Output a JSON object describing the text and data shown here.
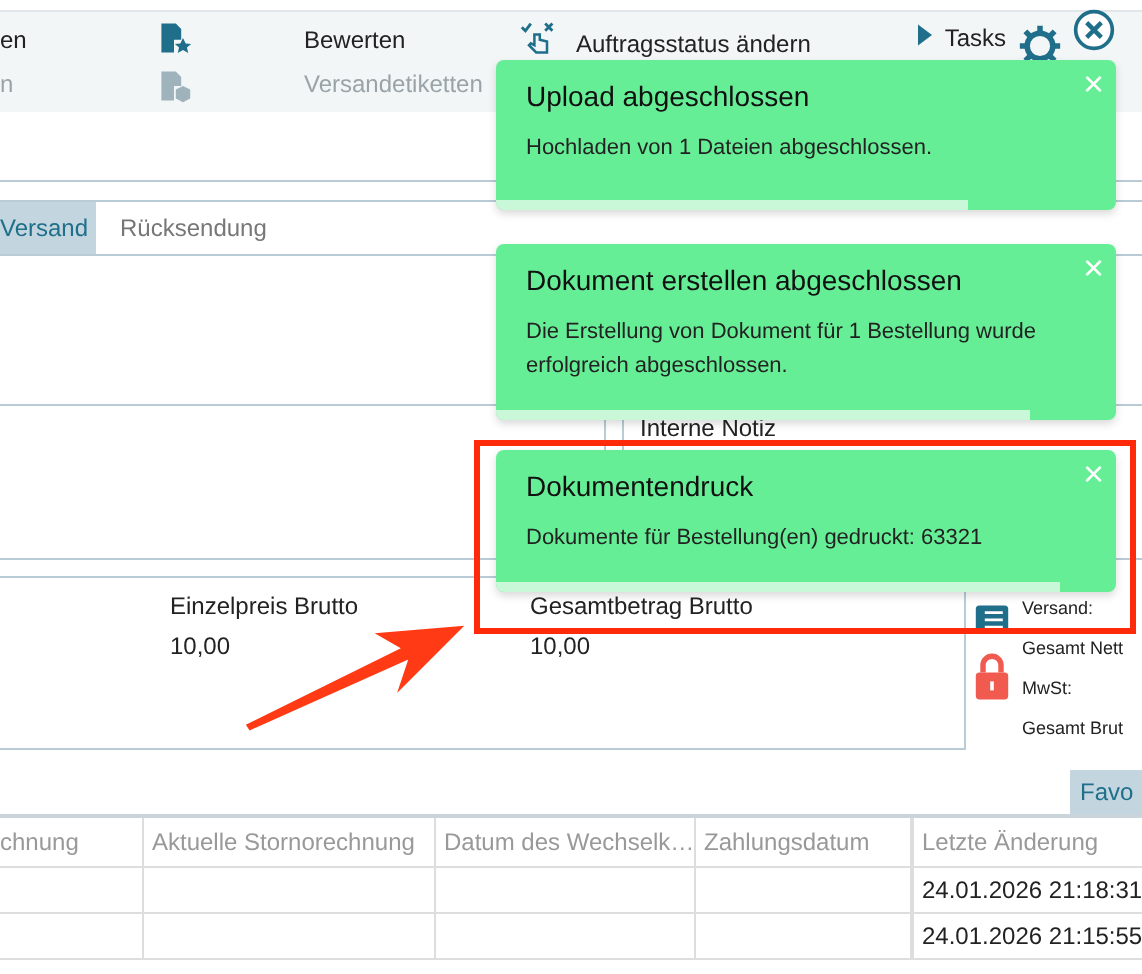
{
  "toolbar": {
    "items": [
      {
        "label": "en",
        "disabled": false
      },
      {
        "label": "n",
        "disabled": true
      },
      {
        "label": "Bewerten",
        "disabled": false
      },
      {
        "label": "Versandetiketten",
        "disabled": true
      },
      {
        "label": "Auftragsstatus ändern",
        "disabled": false
      }
    ],
    "tasks": "Tasks"
  },
  "tabs": [
    {
      "label": "Versand",
      "selected": true
    },
    {
      "label": "Rücksendung",
      "selected": false
    }
  ],
  "notes_label": "Interne Notiz",
  "item": {
    "columns": [
      {
        "label": "Einzelpreis Brutto",
        "value": "10,00"
      },
      {
        "label": "Gesamtbetrag Brutto",
        "value": "10,00"
      }
    ]
  },
  "summary": [
    "Versand:",
    "Gesamt Nett",
    "MwSt:",
    "Gesamt Brut"
  ],
  "favorites_button": "Favo",
  "table": {
    "columns": [
      "chnung",
      "Aktuelle Stornorechnung",
      "Datum des Wechselk…",
      "Zahlungsdatum",
      "Letzte Änderung"
    ],
    "rows": [
      [
        "",
        "",
        "",
        "",
        "24.01.2026 21:18:31"
      ],
      [
        "",
        "",
        "",
        "",
        "24.01.2026 21:15:55"
      ]
    ]
  },
  "toasts": [
    {
      "title": "Upload abgeschlossen",
      "message": "Hochladen von 1 Dateien abgeschlossen.",
      "close": "×",
      "level": 0.76,
      "highlighted": false
    },
    {
      "title": "Dokument erstellen abgeschlossen",
      "message": "Die Erstellung von Dokument für 1 Bestellung wurde erfolgreich abgeschlossen.",
      "close": "×",
      "level": 0.86,
      "highlighted": false
    },
    {
      "title": "Dokumentendruck",
      "message": "Dokumente für Bestellung(en) gedruckt: 63321",
      "close": "×",
      "level": 0.91,
      "highlighted": true
    }
  ]
}
